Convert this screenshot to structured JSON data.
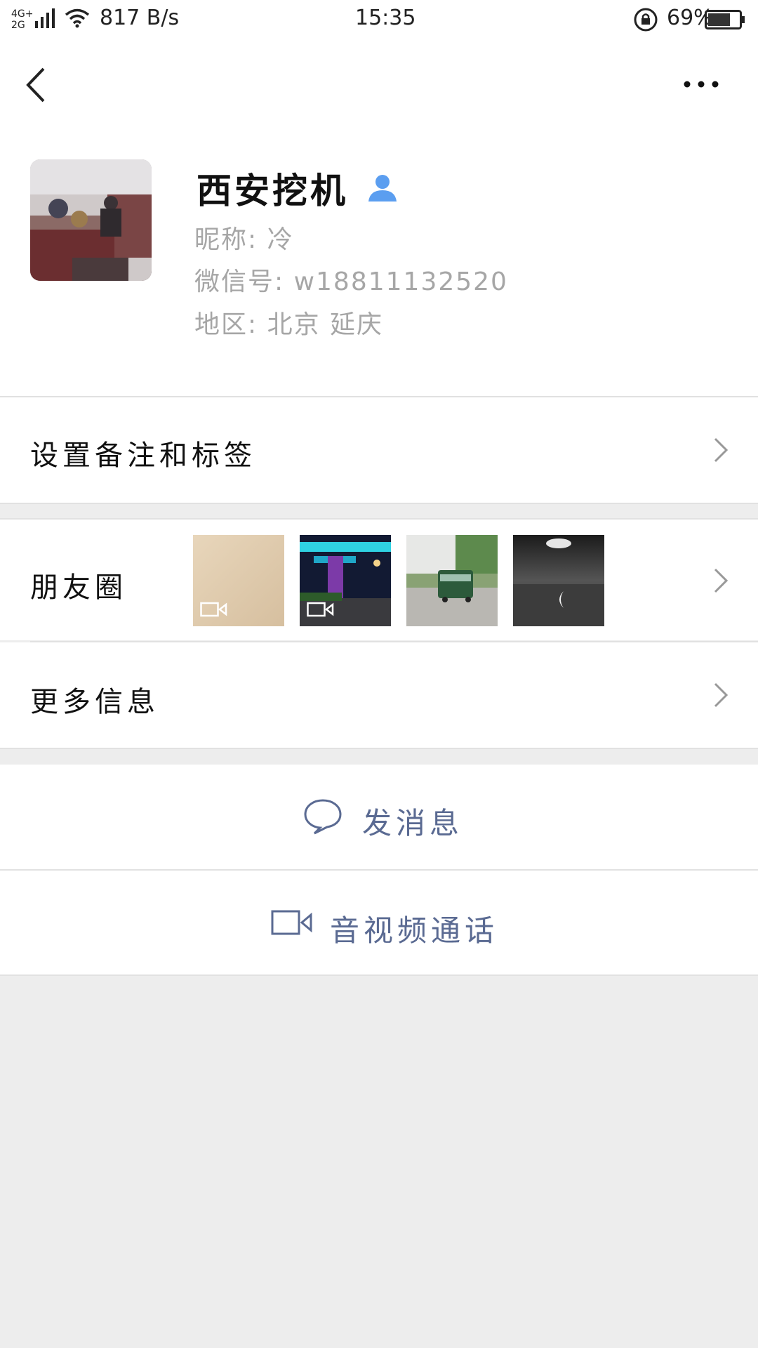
{
  "status_bar": {
    "network": "4G+ 2G",
    "speed": "817 B/s",
    "time": "15:35",
    "battery": "69%"
  },
  "profile": {
    "name": "西安挖机",
    "nickname": "昵称:  冷",
    "wechat_id": "微信号:  w18811132520",
    "region": "地区:  北京  延庆"
  },
  "menu": {
    "remark_label": "设置备注和标签",
    "moments_label": "朋友圈",
    "more_info_label": "更多信息"
  },
  "moments": {
    "thumbs": [
      {
        "type": "video"
      },
      {
        "type": "video"
      },
      {
        "type": "photo"
      },
      {
        "type": "photo"
      }
    ]
  },
  "actions": {
    "message_label": "发消息",
    "call_label": "音视频通话"
  },
  "colors": {
    "accent_blue": "#5a6a92",
    "person_icon": "#5b9ef0",
    "bg_gray": "#ededed"
  }
}
